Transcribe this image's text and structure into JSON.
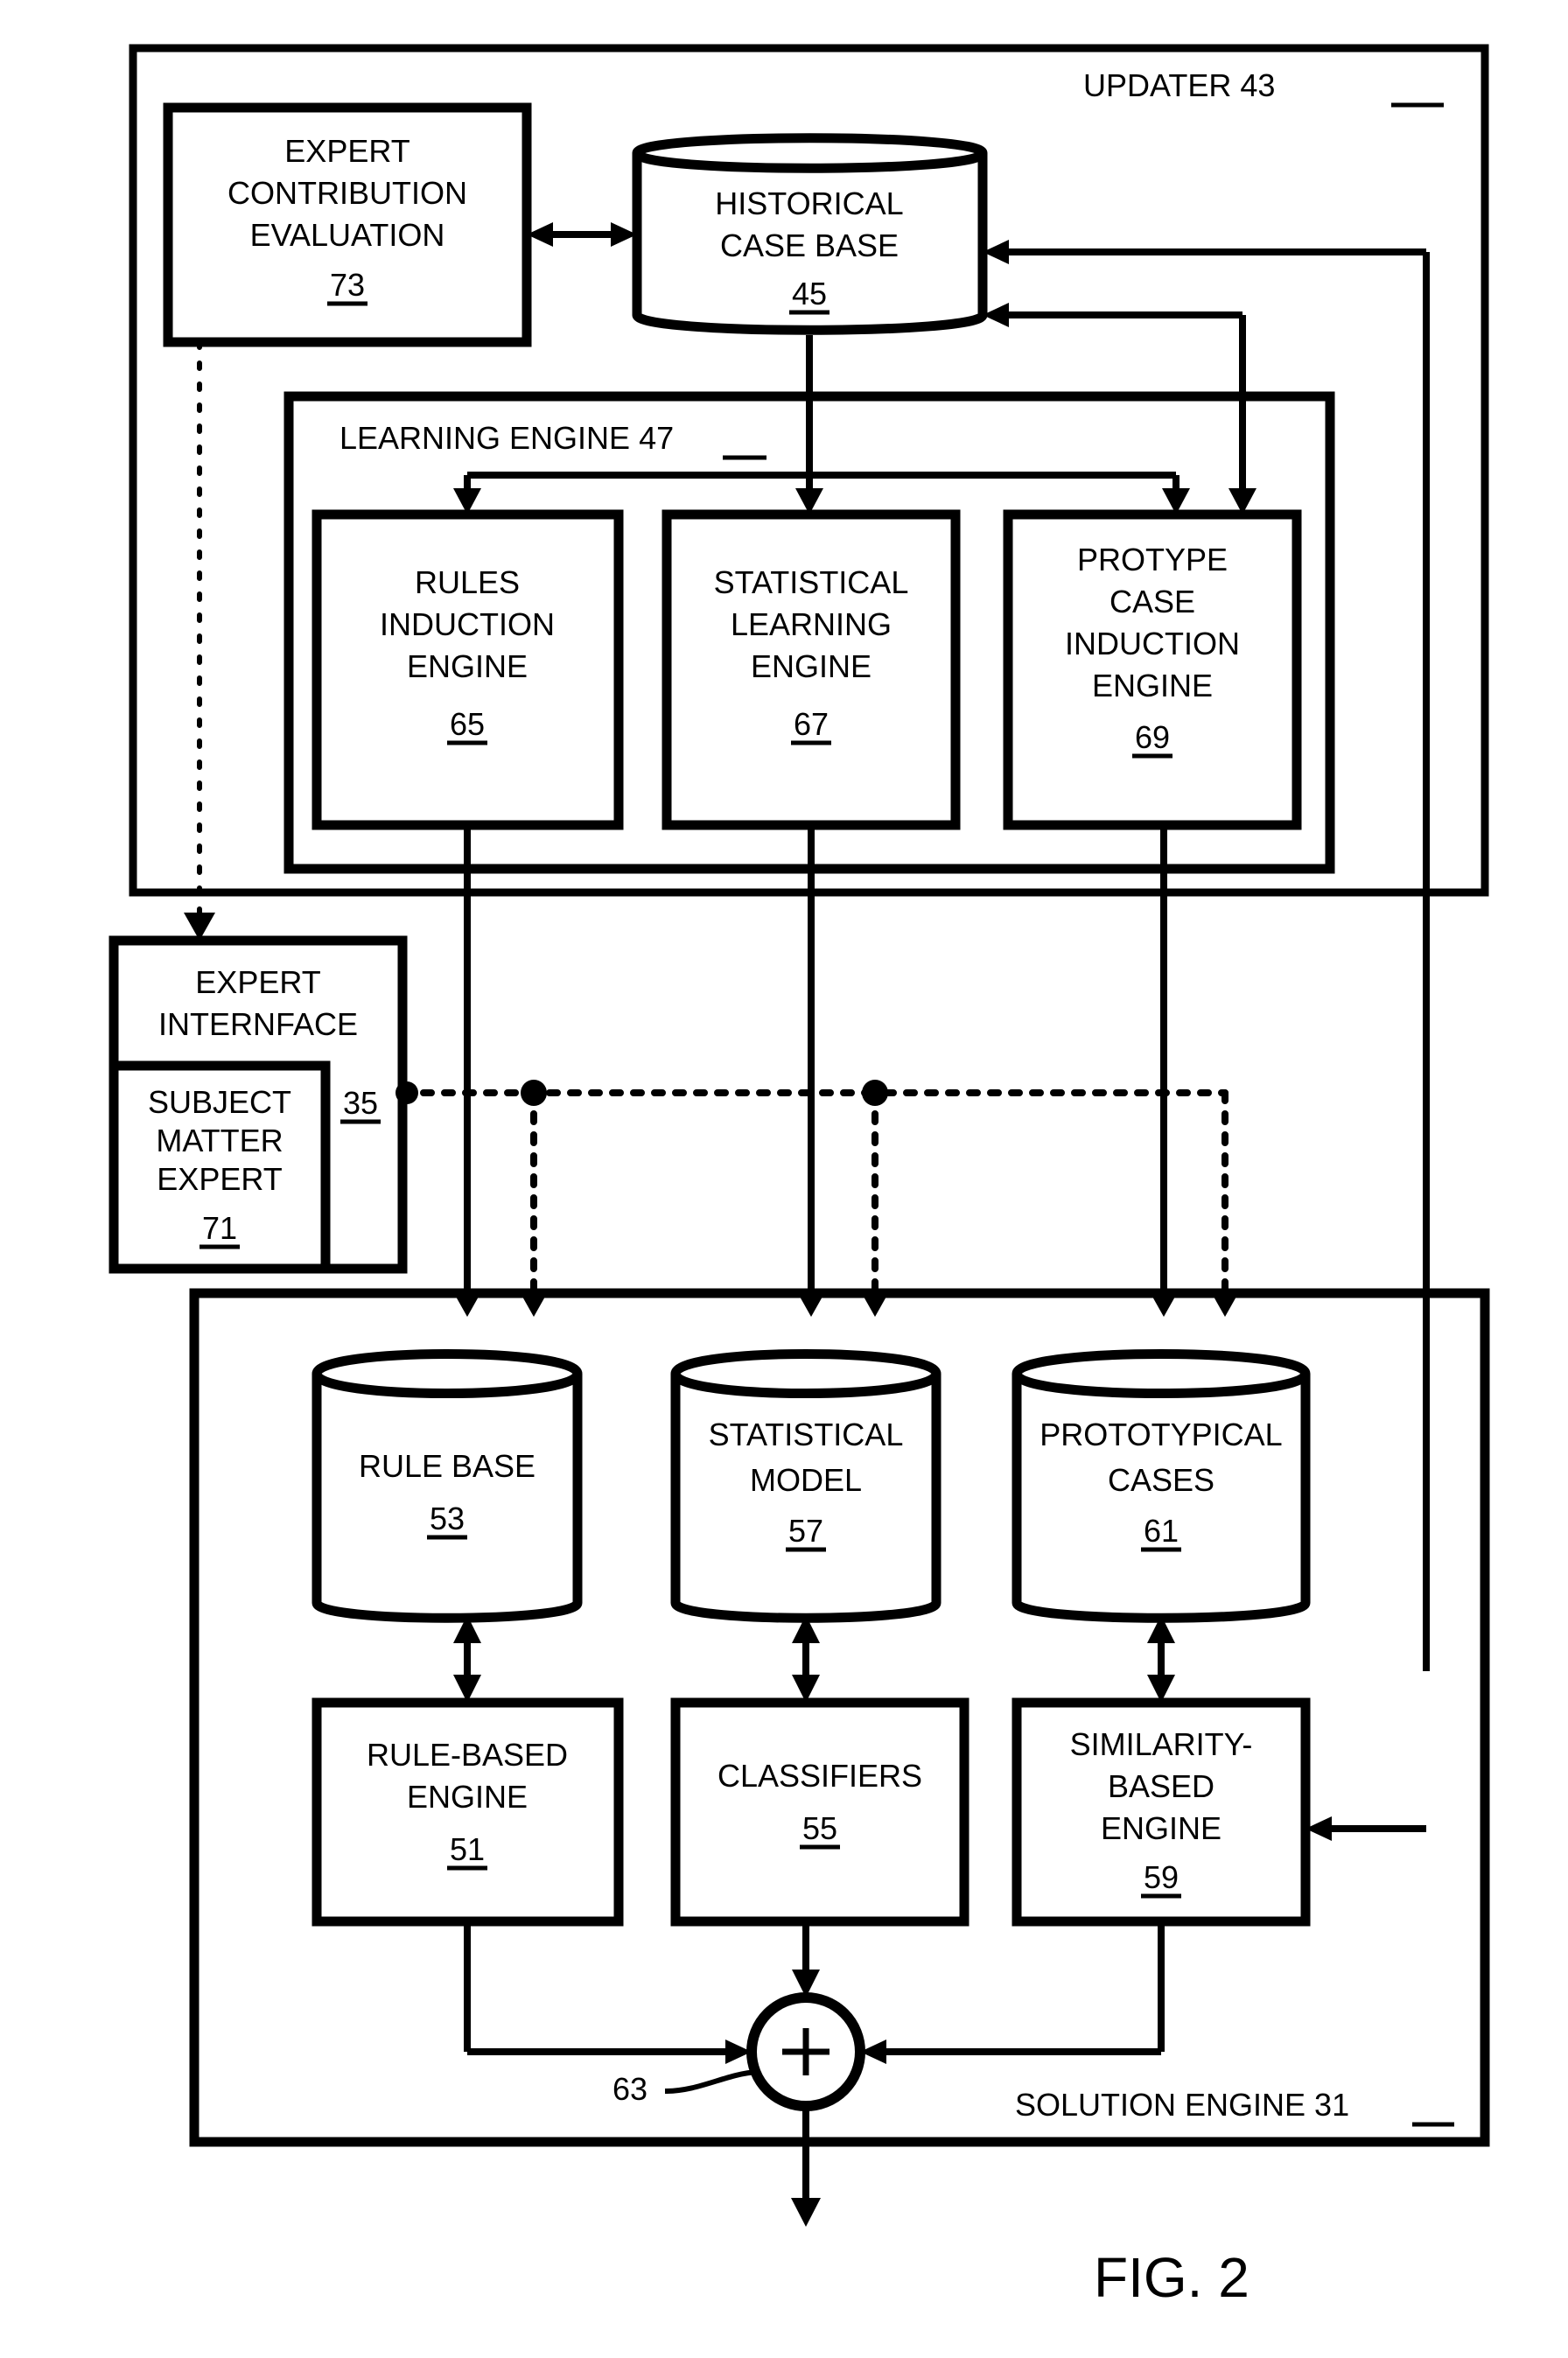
{
  "figure": {
    "caption": "FIG. 2",
    "title": "Updater and Solution Engine block diagram"
  },
  "containers": [
    {
      "id": "updater",
      "label": "UPDATER",
      "ref": "43"
    },
    {
      "id": "learning_engine",
      "label": "LEARNING ENGINE",
      "ref": "47"
    },
    {
      "id": "solution_engine",
      "label": "SOLUTION ENGINE",
      "ref": "31"
    }
  ],
  "blocks": {
    "expert_contribution_evaluation": {
      "lines": [
        "EXPERT",
        "CONTRIBUTION",
        "EVALUATION"
      ],
      "ref": "73"
    },
    "historical_case_base": {
      "lines": [
        "HISTORICAL",
        "CASE BASE"
      ],
      "ref": "45",
      "shape": "cylinder"
    },
    "rules_induction_engine": {
      "lines": [
        "RULES",
        "INDUCTION",
        "ENGINE"
      ],
      "ref": "65"
    },
    "statistical_learning_engine": {
      "lines": [
        "STATISTICAL",
        "LEARNING",
        "ENGINE"
      ],
      "ref": "67"
    },
    "protype_case_induction_engine": {
      "lines": [
        "PROTYPE",
        "CASE",
        "INDUCTION",
        "ENGINE"
      ],
      "ref": "69"
    },
    "expert_interface": {
      "lines": [
        "EXPERT",
        "INTERNFACE"
      ],
      "ref": "35"
    },
    "subject_matter_expert": {
      "lines": [
        "SUBJECT",
        "MATTER",
        "EXPERT"
      ],
      "ref": "71"
    },
    "rule_base": {
      "lines": [
        "RULE BASE"
      ],
      "ref": "53",
      "shape": "cylinder"
    },
    "statistical_model": {
      "lines": [
        "STATISTICAL",
        "MODEL"
      ],
      "ref": "57",
      "shape": "cylinder"
    },
    "prototypical_cases": {
      "lines": [
        "PROTOTYPICAL",
        "CASES"
      ],
      "ref": "61",
      "shape": "cylinder"
    },
    "rule_based_engine": {
      "lines": [
        "RULE-BASED",
        "ENGINE"
      ],
      "ref": "51"
    },
    "classifiers": {
      "lines": [
        "CLASSIFIERS"
      ],
      "ref": "55"
    },
    "similarity_based_engine": {
      "lines": [
        "SIMILARITY-",
        "BASED",
        "ENGINE"
      ],
      "ref": "59"
    },
    "summation_node": {
      "symbol": "+",
      "ref": "63"
    }
  },
  "labels": {
    "updater_title": "UPDATER 43",
    "learning_engine_title": "LEARNING ENGINE 47",
    "solution_engine_title": "SOLUTION ENGINE 31",
    "expert_interface_ref": "35",
    "summation_ref": "63"
  },
  "colors": {
    "ink": "#000000",
    "paper": "#ffffff"
  }
}
